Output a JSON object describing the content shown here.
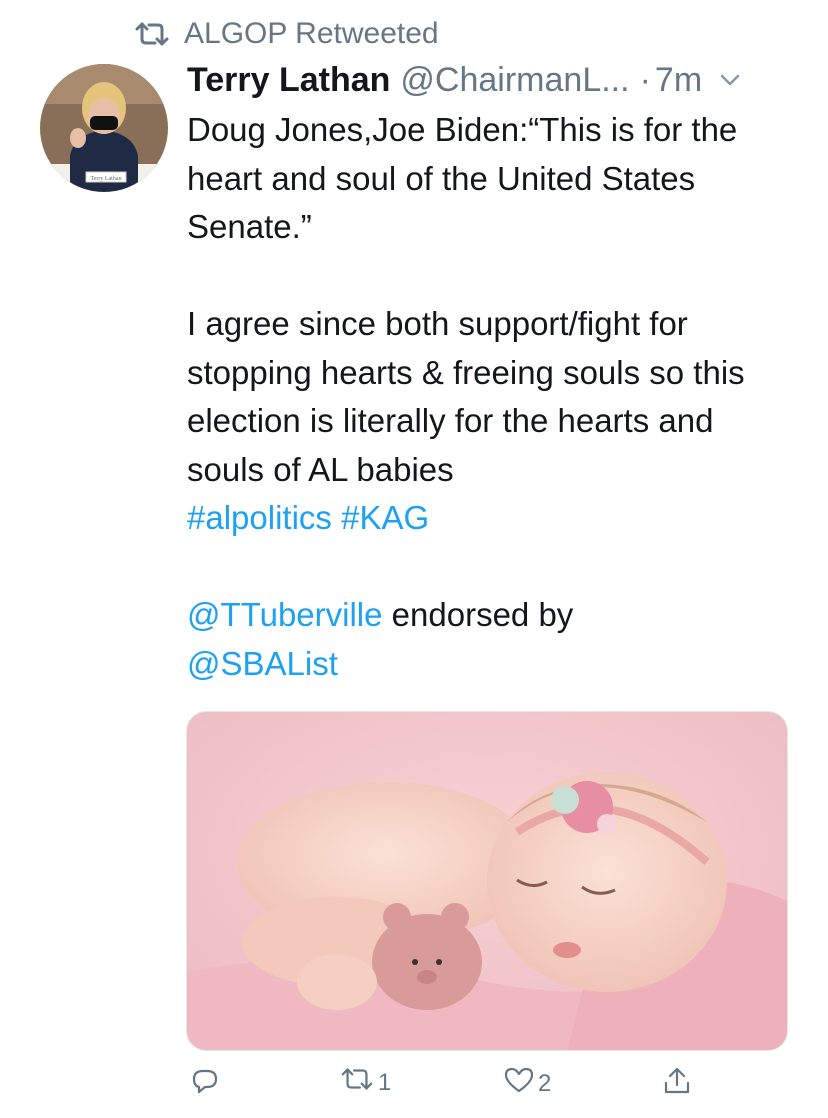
{
  "retweet_banner": {
    "icon": "retweet-icon",
    "text": "ALGOP Retweeted"
  },
  "tweet": {
    "author_name": "Terry Lathan",
    "author_handle": "@ChairmanL...",
    "dot": "·",
    "time": "7m",
    "avatar_caption": "Terry Lathan",
    "text": {
      "quote_line": "Doug Jones,Joe Biden:“This is for the heart and soul of the United States Senate.”",
      "body_line": "I agree since both support/fight for stopping hearts & freeing souls so this election is literally for the hearts and souls of AL babies",
      "hashtags": [
        "#alpolitics",
        "#KAG"
      ],
      "mention_1": "@TTuberville",
      "mention_text": " endorsed by",
      "mention_2": "@SBAList"
    },
    "media": {
      "description_icon": "baby-photo-image"
    },
    "actions": {
      "reply": {
        "icon": "reply-icon",
        "count": ""
      },
      "retweet": {
        "icon": "retweet-icon",
        "count": "1"
      },
      "like": {
        "icon": "heart-icon",
        "count": "2"
      },
      "share": {
        "icon": "share-icon",
        "count": ""
      }
    }
  },
  "colors": {
    "link": "#1da1f2",
    "secondary_text": "#657786",
    "text": "#14171a"
  }
}
